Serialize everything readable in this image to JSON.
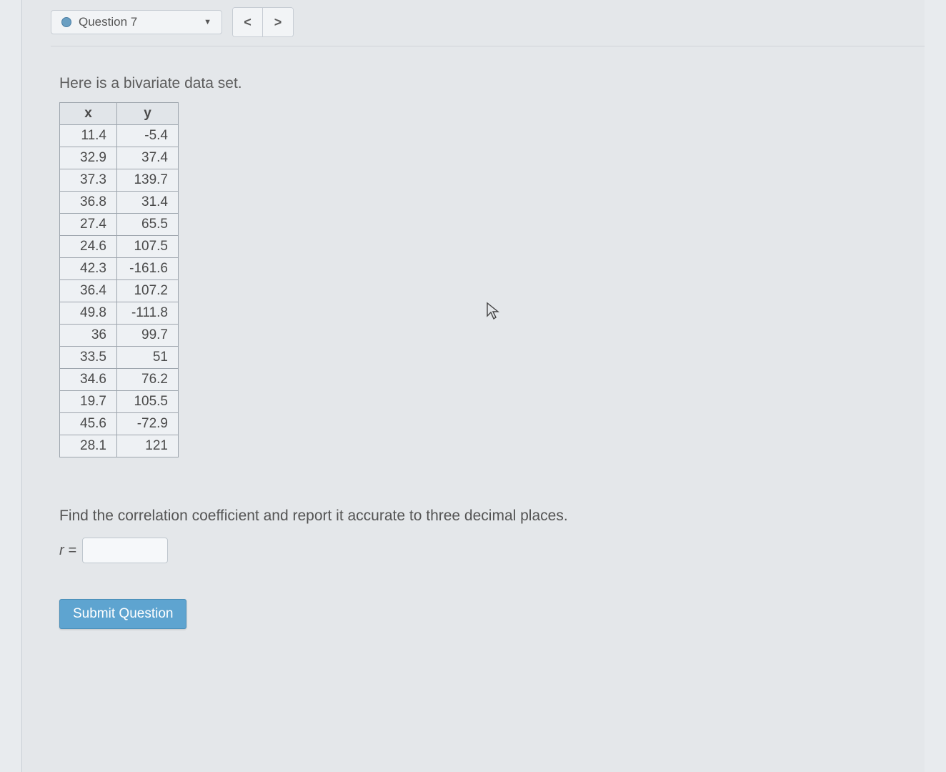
{
  "header": {
    "question_label": "Question 7",
    "prev_symbol": "<",
    "next_symbol": ">"
  },
  "intro_text": "Here is a bivariate data set.",
  "table": {
    "col_x": "x",
    "col_y": "y",
    "rows": [
      {
        "x": "11.4",
        "y": "-5.4"
      },
      {
        "x": "32.9",
        "y": "37.4"
      },
      {
        "x": "37.3",
        "y": "139.7"
      },
      {
        "x": "36.8",
        "y": "31.4"
      },
      {
        "x": "27.4",
        "y": "65.5"
      },
      {
        "x": "24.6",
        "y": "107.5"
      },
      {
        "x": "42.3",
        "y": "-161.6"
      },
      {
        "x": "36.4",
        "y": "107.2"
      },
      {
        "x": "49.8",
        "y": "-111.8"
      },
      {
        "x": "36",
        "y": "99.7"
      },
      {
        "x": "33.5",
        "y": "51"
      },
      {
        "x": "34.6",
        "y": "76.2"
      },
      {
        "x": "19.7",
        "y": "105.5"
      },
      {
        "x": "45.6",
        "y": "-72.9"
      },
      {
        "x": "28.1",
        "y": "121"
      }
    ]
  },
  "prompt_text": "Find the correlation coefficient and report it accurate to three decimal places.",
  "answer": {
    "label": "r =",
    "value": ""
  },
  "submit_label": "Submit Question"
}
